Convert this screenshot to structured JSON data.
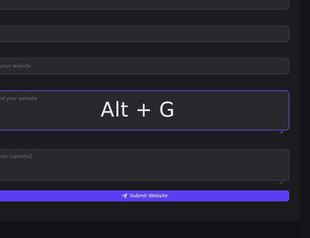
{
  "form": {
    "website_url": {
      "placeholder": ""
    },
    "website_name": {
      "placeholder": ""
    },
    "category": {
      "placeholder": "your website"
    },
    "description": {
      "placeholder": "of your website"
    },
    "comments": {
      "placeholder": "nts (optional)"
    },
    "submit_label": "Submit Website"
  },
  "overlay": {
    "shortcut": "Alt + G"
  },
  "icons": {
    "submit": "send-icon",
    "resize": "resize-handle-icon"
  },
  "colors": {
    "accent": "#5b3ff2",
    "focus_border": "#5b4bd6",
    "background": "#1c1c1f",
    "field": "#29292d"
  }
}
